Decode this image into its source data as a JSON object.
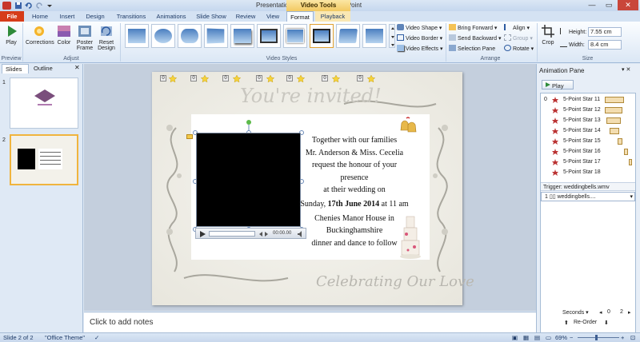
{
  "titlebar": {
    "title": "Presentation1 - Microsoft PowerPoint",
    "context_group": "Video Tools",
    "min": "—",
    "max": "▭",
    "close": "✕"
  },
  "tabs": {
    "file": "File",
    "items": [
      "Home",
      "Insert",
      "Design",
      "Transitions",
      "Animations",
      "Slide Show",
      "Review",
      "View",
      "Format",
      "Playback"
    ]
  },
  "ribbon": {
    "preview": {
      "play": "Play",
      "group": "Preview"
    },
    "adjust": {
      "corrections": "Corrections",
      "color": "Color",
      "poster_frame_1": "Poster",
      "poster_frame_2": "Frame",
      "reset_design_1": "Reset",
      "reset_design_2": "Design",
      "group": "Adjust"
    },
    "video_styles": {
      "shape": "Video Shape",
      "border": "Video Border",
      "effects": "Video Effects",
      "group": "Video Styles"
    },
    "arrange": {
      "bring_forward": "Bring Forward",
      "send_backward": "Send Backward",
      "selection_pane": "Selection Pane",
      "align": "Align",
      "group_btn": "Group",
      "rotate": "Rotate",
      "group": "Arrange"
    },
    "size": {
      "crop": "Crop",
      "height_label": "Height:",
      "height_value": "7.55 cm",
      "width_label": "Width:",
      "width_value": "8.4 cm",
      "group": "Size"
    }
  },
  "leftpane": {
    "tab_slides": "Slides",
    "tab_outline": "Outline",
    "close": "✕",
    "slide1_num": "1",
    "slide2_num": "2"
  },
  "slide": {
    "top_script": "You're invited!",
    "bottom_script": "Celebrating Our Love",
    "invite_lines": [
      "Together with our families",
      "Mr. Anderson & Miss. Cecelia",
      "request the honour of your presence",
      "at their wedding  on"
    ],
    "date_prefix": "Sunday, ",
    "date_bold": "17th June 2014",
    "date_suffix": " at 11 am",
    "venue_lines": [
      "Chenies Manor House in",
      "Buckinghamshire",
      "dinner and dance to follow"
    ],
    "video_time": "00:00.00",
    "anim_tags": [
      "0",
      "0",
      "0",
      "0",
      "0",
      "0",
      "0"
    ]
  },
  "notes": {
    "placeholder": "Click to add notes"
  },
  "animpane": {
    "title": "Animation Pane",
    "play": "Play",
    "items": [
      {
        "num": "0",
        "label": "5-Point Star 11"
      },
      {
        "num": "",
        "label": "5-Point Star 12"
      },
      {
        "num": "",
        "label": "5-Point Star 13"
      },
      {
        "num": "",
        "label": "5-Point Star 14"
      },
      {
        "num": "",
        "label": "5-Point Star 15"
      },
      {
        "num": "",
        "label": "5-Point Star 16"
      },
      {
        "num": "",
        "label": "5-Point Star 17"
      },
      {
        "num": "",
        "label": "5-Point Star 18"
      }
    ],
    "trigger": "Trigger: weddingbells.wmv",
    "media_item": "1 ▯▯  weddingbells....",
    "seconds": "Seconds ▾",
    "zero": "0",
    "two": "2",
    "reorder": "Re-Order"
  },
  "statusbar": {
    "slide_of": "Slide 2 of 2",
    "theme": "\"Office Theme\"",
    "zoom": "69%"
  },
  "colors": {
    "file_tab": "#d63c1a",
    "context_tab": "#f2c961",
    "accent": "#1e3a66"
  }
}
